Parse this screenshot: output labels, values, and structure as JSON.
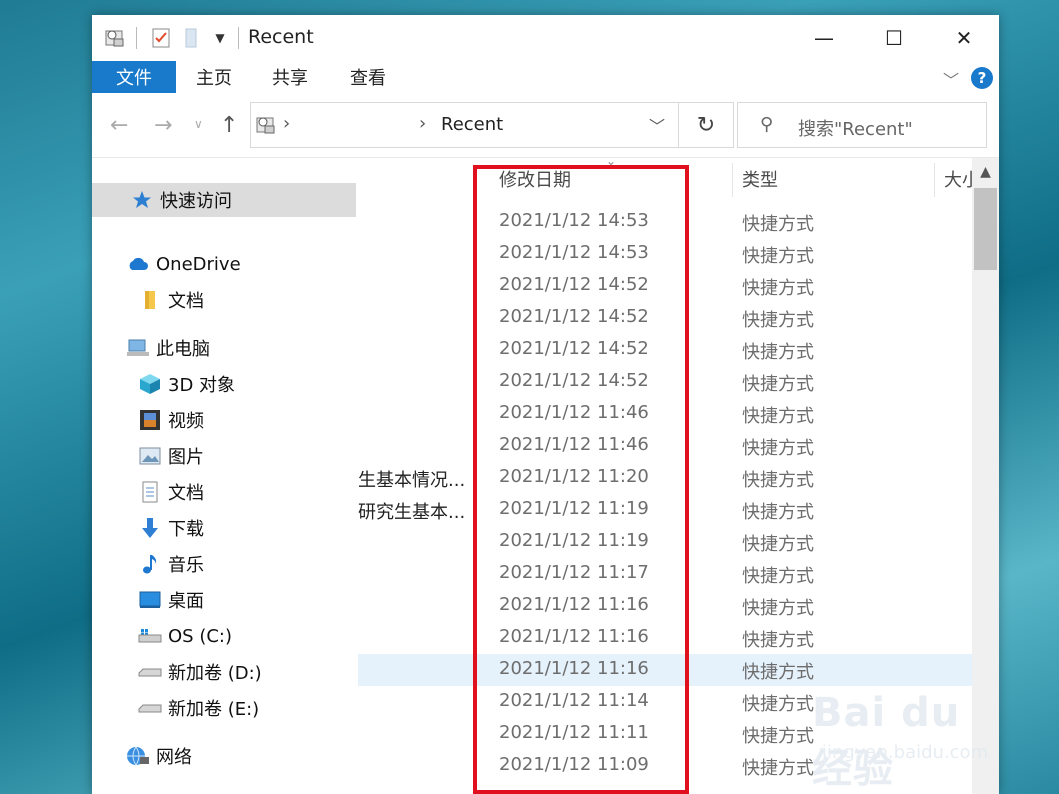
{
  "titlebar": {
    "title": "Recent",
    "minimize": "—",
    "maximize": "☐",
    "close": "✕"
  },
  "ribbon": {
    "tabs": [
      "文件",
      "主页",
      "共享",
      "查看"
    ],
    "help": "?"
  },
  "address": {
    "path": "Recent",
    "search_placeholder": "搜索\"Recent\""
  },
  "sidebar": {
    "items": [
      {
        "label": "快速访问",
        "icon": "star-pin-icon"
      },
      {
        "label": "OneDrive",
        "icon": "cloud-icon"
      },
      {
        "label": "文档",
        "icon": "folder-icon"
      },
      {
        "label": "此电脑",
        "icon": "computer-icon"
      },
      {
        "label": "3D 对象",
        "icon": "cube-icon"
      },
      {
        "label": "视频",
        "icon": "film-icon"
      },
      {
        "label": "图片",
        "icon": "picture-icon"
      },
      {
        "label": "文档",
        "icon": "document-icon"
      },
      {
        "label": "下载",
        "icon": "download-arrow-icon"
      },
      {
        "label": "音乐",
        "icon": "music-note-icon"
      },
      {
        "label": "桌面",
        "icon": "desktop-icon"
      },
      {
        "label": "OS (C:)",
        "icon": "drive-icon"
      },
      {
        "label": "新加卷 (D:)",
        "icon": "drive-icon"
      },
      {
        "label": "新加卷 (E:)",
        "icon": "drive-icon"
      },
      {
        "label": "网络",
        "icon": "network-icon"
      }
    ]
  },
  "columns": {
    "date": "修改日期",
    "type": "类型",
    "size": "大小"
  },
  "rows": [
    {
      "name": "",
      "date": "2021/1/12 14:53",
      "type": "快捷方式"
    },
    {
      "name": "",
      "date": "2021/1/12 14:53",
      "type": "快捷方式"
    },
    {
      "name": "",
      "date": "2021/1/12 14:52",
      "type": "快捷方式"
    },
    {
      "name": "",
      "date": "2021/1/12 14:52",
      "type": "快捷方式"
    },
    {
      "name": "",
      "date": "2021/1/12 14:52",
      "type": "快捷方式"
    },
    {
      "name": "",
      "date": "2021/1/12 14:52",
      "type": "快捷方式"
    },
    {
      "name": "",
      "date": "2021/1/12 11:46",
      "type": "快捷方式"
    },
    {
      "name": "",
      "date": "2021/1/12 11:46",
      "type": "快捷方式"
    },
    {
      "name": "生基本情况...",
      "date": "2021/1/12 11:20",
      "type": "快捷方式"
    },
    {
      "name": "研究生基本...",
      "date": "2021/1/12 11:19",
      "type": "快捷方式"
    },
    {
      "name": "",
      "date": "2021/1/12 11:19",
      "type": "快捷方式"
    },
    {
      "name": "",
      "date": "2021/1/12 11:17",
      "type": "快捷方式"
    },
    {
      "name": "",
      "date": "2021/1/12 11:16",
      "type": "快捷方式"
    },
    {
      "name": "",
      "date": "2021/1/12 11:16",
      "type": "快捷方式"
    },
    {
      "name": "",
      "date": "2021/1/12 11:16",
      "type": "快捷方式",
      "highlighted": true
    },
    {
      "name": "",
      "date": "2021/1/12 11:14",
      "type": "快捷方式"
    },
    {
      "name": "",
      "date": "2021/1/12 11:11",
      "type": "快捷方式"
    },
    {
      "name": "",
      "date": "2021/1/12 11:09",
      "type": "快捷方式"
    }
  ],
  "watermark": {
    "brand": "Bai du 经验",
    "url": "jingyan.baidu.com"
  },
  "colors": {
    "accent": "#1979ca",
    "highlight_box": "#e0101f"
  }
}
